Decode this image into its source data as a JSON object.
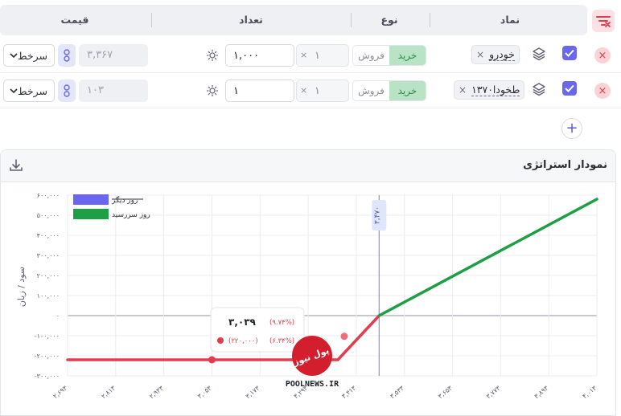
{
  "header": {
    "symbol": "نماد",
    "type": "نوع",
    "count": "تعداد",
    "price": "قیمت"
  },
  "rows": [
    {
      "symbol": "خودرو",
      "sell_label": "فروش",
      "buy_label": "خرید",
      "multiplier": "۱",
      "count": "۱,۰۰۰",
      "price": "۳,۳۶۷",
      "price_type": "سرخط"
    },
    {
      "symbol": "طخودا۱۳۷۰",
      "sell_label": "فروش",
      "buy_label": "خرید",
      "multiplier": "۱",
      "count": "۱",
      "price": "۱۰۳",
      "price_type": "سرخط"
    }
  ],
  "panel": {
    "title": "نمودار استراتژی"
  },
  "chart_data": {
    "type": "line",
    "ylabel": "سود / زیان",
    "y_ticks": [
      "۶۰۰,۰۰۰",
      "۵۰۰,۰۰۰",
      "۴۰۰,۰۰۰",
      "۳۰۰,۰۰۰",
      "۲۰۰,۰۰۰",
      "۱۰۰,۰۰۰",
      "۰",
      "-۱۰۰,۰۰۰",
      "-۲۰۰,۰۰۰",
      "-۳۰۰,۰۰۰"
    ],
    "x_ticks": [
      "۲,۶۹۳",
      "۲,۸۱۳",
      "۲,۹۳۳",
      "۳,۰۵۳",
      "۳,۱۷۳",
      "۳,۲۹۳",
      "۳,۴۱۳",
      "۳,۵۳۳",
      "۳,۶۵۳",
      "۳,۷۷۳",
      "۳,۸۹۳",
      "۴,۰۱۳"
    ],
    "ylim": [
      -300000,
      600000
    ],
    "xlim": [
      2693,
      4013
    ],
    "vertical_marker": {
      "x": 3470,
      "label": "۳,۴۷۰"
    },
    "legend": [
      {
        "name": "روز دیگر",
        "color": "#6b66f0"
      },
      {
        "name": "روز سررسید",
        "color": "#1e9e45"
      }
    ],
    "series": [
      {
        "name": "روز سررسید",
        "loss_color": "#e23d4f",
        "profit_color": "#1e9e45",
        "x": [
          2693,
          3367,
          3470,
          4013
        ],
        "y": [
          -220000,
          -220000,
          0,
          580000
        ]
      }
    ],
    "markers": [
      {
        "x": 3053,
        "y": -220000
      },
      {
        "x": 3383,
        "y": -103000
      }
    ],
    "tooltip": {
      "value": "۳,۰۳۹",
      "pct_top": "(۹.۷۴%)",
      "loss": "(۲۲۰,۰۰۰)",
      "pct_bottom": "(۶.۳۴%)"
    },
    "colors": {
      "axis_zero": "#c7c8cf",
      "grid": "#ececf1",
      "marker_line": "#8f8be8"
    }
  },
  "watermark": {
    "site": "POOLNEWS.IR",
    "logo_text": "پول نیوز"
  }
}
